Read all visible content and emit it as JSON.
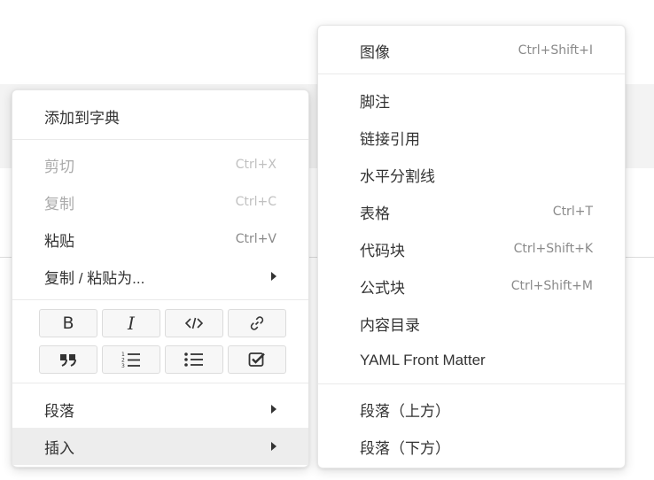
{
  "context_menu": {
    "add_to_dictionary": "添加到字典",
    "cut": {
      "label": "剪切",
      "shortcut": "Ctrl+X"
    },
    "copy": {
      "label": "复制",
      "shortcut": "Ctrl+C"
    },
    "paste": {
      "label": "粘贴",
      "shortcut": "Ctrl+V"
    },
    "copy_paste_as": "复制 / 粘贴为...",
    "format_buttons": {
      "bold_glyph": "B",
      "italic_glyph": "I",
      "icons": [
        "bold-icon",
        "italic-icon",
        "code-icon",
        "link-icon",
        "quote-icon",
        "ordered-list-icon",
        "unordered-list-icon",
        "task-list-icon"
      ]
    },
    "paragraph": "段落",
    "insert": "插入"
  },
  "insert_submenu": {
    "image": {
      "label": "图像",
      "shortcut": "Ctrl+Shift+I"
    },
    "footnote": {
      "label": "脚注"
    },
    "link_reference": {
      "label": "链接引用"
    },
    "horizontal_rule": {
      "label": "水平分割线"
    },
    "table": {
      "label": "表格",
      "shortcut": "Ctrl+T"
    },
    "code_block": {
      "label": "代码块",
      "shortcut": "Ctrl+Shift+K"
    },
    "math_block": {
      "label": "公式块",
      "shortcut": "Ctrl+Shift+M"
    },
    "toc": {
      "label": "内容目录"
    },
    "yaml_front_matter": {
      "label": "YAML Front Matter"
    },
    "paragraph_above": {
      "label": "段落（上方）"
    },
    "paragraph_below": {
      "label": "段落（下方）"
    }
  },
  "colors": {
    "active_row": "#ededed",
    "disabled_text": "#aaaaaa",
    "shortcut_text": "#8a8a8a"
  }
}
